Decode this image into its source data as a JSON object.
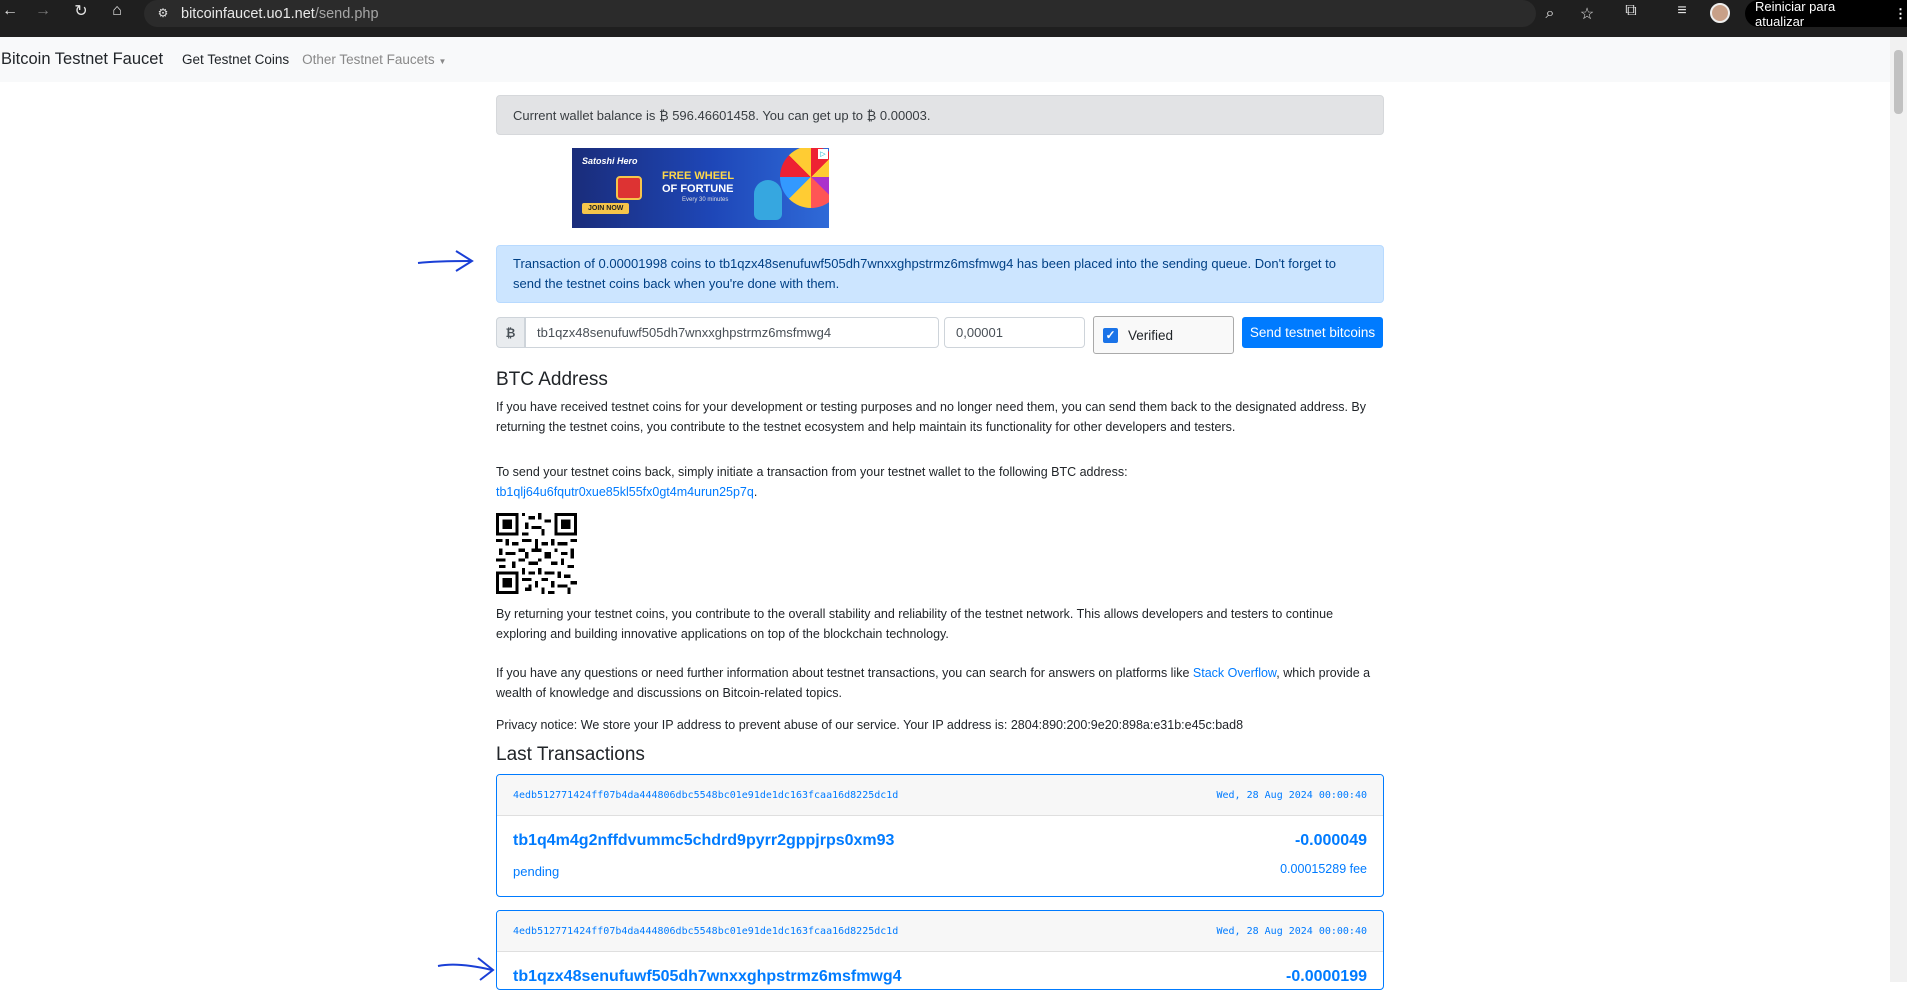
{
  "browser": {
    "url_domain": "bitcoinfaucet.uo1.net",
    "url_path": "/send.php",
    "update_button": "Reiniciar para atualizar"
  },
  "navbar": {
    "brand": "Bitcoin Testnet Faucet",
    "links": [
      "Get Testnet Coins",
      "Other Testnet Faucets"
    ]
  },
  "balance_alert": "Current wallet balance is ₿ 596.46601458. You can get up to ₿ 0.00003.",
  "ad": {
    "brand": "Satoshi Hero",
    "headline_1": "FREE WHEEL",
    "headline_2": "OF FORTUNE",
    "sub": "Every 30 minutes",
    "cta": "JOIN NOW"
  },
  "success_alert": "Transaction of 0.00001998 coins to tb1qzx48senufuwf505dh7wnxxghpstrmz6msfmwg4 has been placed into the sending queue. Don't forget to send the testnet coins back when you're done with them.",
  "form": {
    "currency_symbol": "₿",
    "address_value": "tb1qzx48senufuwf505dh7wnxxghpstrmz6msfmwg4",
    "amount_value": "0,00001",
    "captcha_label": "Verified",
    "send_button": "Send testnet bitcoins"
  },
  "btc_address_section": {
    "heading": "BTC Address",
    "para1": "If you have received testnet coins for your development or testing purposes and no longer need them, you can send them back to the designated address. By returning the testnet coins, you contribute to the testnet ecosystem and help maintain its functionality for other developers and testers.",
    "para2": "To send your testnet coins back, simply initiate a transaction from your testnet wallet to the following BTC address:",
    "return_address": "tb1qlj64u6fqutr0xue85kl55fx0gt4m4urun25p7q",
    "para3": "By returning your testnet coins, you contribute to the overall stability and reliability of the testnet network. This allows developers and testers to continue exploring and building innovative applications on top of the blockchain technology.",
    "para4_before": "If you have any questions or need further information about testnet transactions, you can search for answers on platforms like ",
    "para4_link": "Stack Overflow",
    "para4_after": ", which provide a wealth of knowledge and discussions on Bitcoin-related topics.",
    "privacy": "Privacy notice: We store your IP address to prevent abuse of our service. Your IP address is: 2804:890:200:9e20:898a:e31b:e45c:bad8"
  },
  "last_transactions": {
    "heading": "Last Transactions",
    "items": [
      {
        "txid": "4edb512771424ff07b4da444806dbc5548bc01e91de1dc163fcaa16d8225dc1d",
        "date": "Wed, 28 Aug 2024 00:00:40",
        "address": "tb1q4m4g2nffdvummc5chdrd9pyrr2gppjrps0xm93",
        "amount": "-0.000049",
        "status": "pending",
        "fee": "0.00015289 fee"
      },
      {
        "txid": "4edb512771424ff07b4da444806dbc5548bc01e91de1dc163fcaa16d8225dc1d",
        "date": "Wed, 28 Aug 2024 00:00:40",
        "address": "tb1qzx48senufuwf505dh7wnxxghpstrmz6msfmwg4",
        "amount": "-0.0000199"
      }
    ]
  },
  "colors": {
    "primary": "#007bff",
    "alert_info_bg": "#cce5ff",
    "alert_secondary_bg": "#e2e3e5",
    "annotation_arrow": "#1a3fd6"
  }
}
